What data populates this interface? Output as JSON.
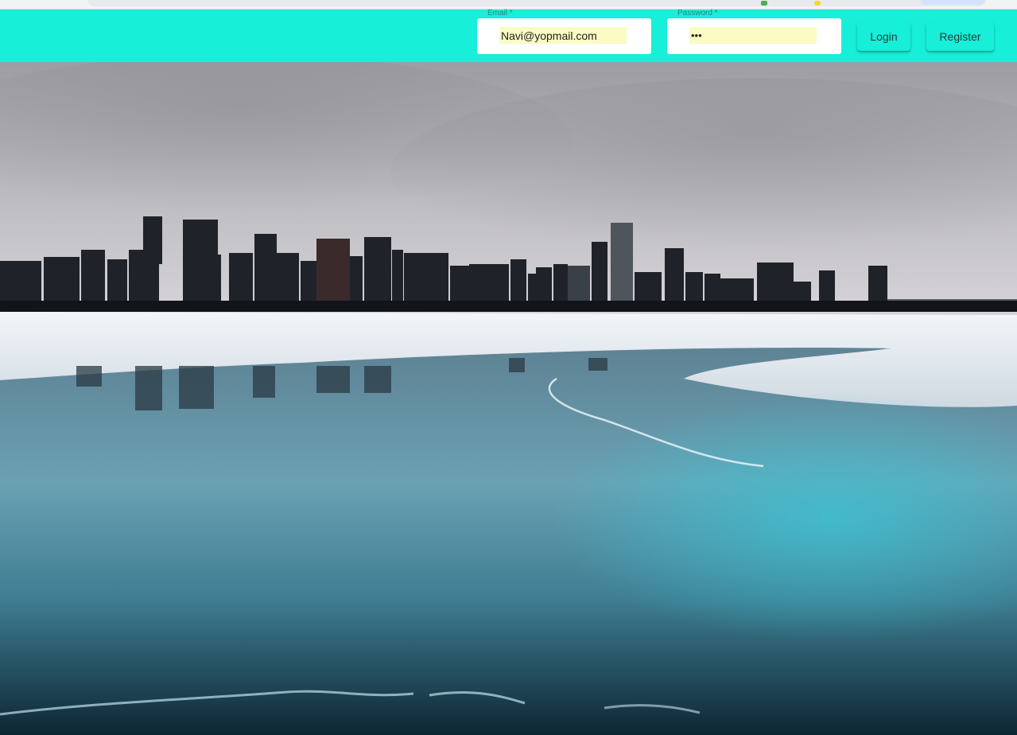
{
  "header": {
    "email_label": "Email *",
    "email_value": "Navi@yopmail.com",
    "password_label": "Password *",
    "password_value": "•••",
    "login_label": "Login",
    "register_label": "Register",
    "accent_color": "#17efd8"
  },
  "hero": {
    "image": "city-skyline-frozen-lake"
  }
}
